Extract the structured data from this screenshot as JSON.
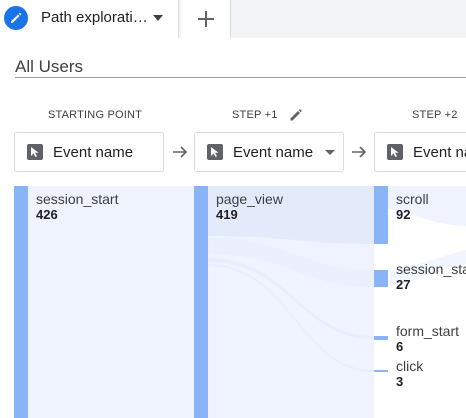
{
  "tab": {
    "title": "Path explorati…",
    "icon": "exploration-pencil-icon",
    "menu_icon": "dropdown-caret-icon",
    "add_icon": "plus-icon"
  },
  "segment": {
    "label": "All Users"
  },
  "steps": [
    {
      "header": "STARTING POINT",
      "selector_label": "Event name",
      "has_menu": false
    },
    {
      "header": "STEP +1",
      "selector_label": "Event name",
      "has_menu": true
    },
    {
      "header": "STEP +2",
      "selector_label": "Event name",
      "has_menu": false
    }
  ],
  "nodes": {
    "start": [
      {
        "name": "session_start",
        "count": "426"
      }
    ],
    "step1": [
      {
        "name": "page_view",
        "count": "419"
      }
    ],
    "step2": [
      {
        "name": "scroll",
        "count": "92"
      },
      {
        "name": "session_start",
        "count": "27"
      },
      {
        "name": "form_start",
        "count": "6"
      },
      {
        "name": "click",
        "count": "3"
      }
    ]
  },
  "colors": {
    "accent": "#1a73e8",
    "node_bar": "#8ab4f8",
    "flow_fill": "#eef3fd"
  }
}
